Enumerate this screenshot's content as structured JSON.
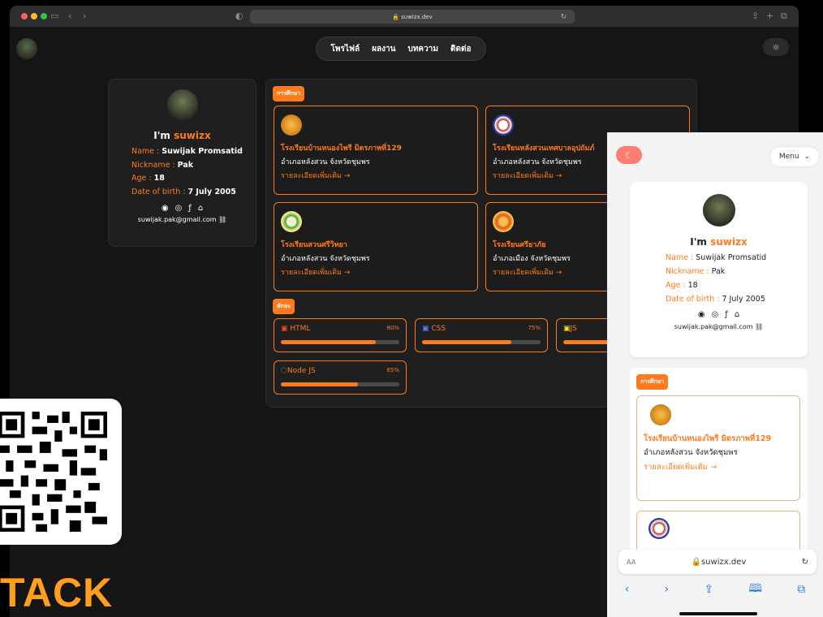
{
  "desktop": {
    "url": "suwizx.dev",
    "nav": [
      "โพรไฟล์",
      "ผลงาน",
      "บทความ",
      "ติดต่อ"
    ],
    "profile": {
      "greeting": "I'm ",
      "name_highlight": "suwizx",
      "name_label": "Name : ",
      "name_value": "Suwijak Promsatid",
      "nick_label": "Nickname : ",
      "nick_value": "Pak",
      "age_label": "Age : ",
      "age_value": "18",
      "dob_label": "Date of birth : ",
      "dob_value": "7 July 2005",
      "email": "suwijak.pak@gmail.com"
    },
    "education_badge": "การศึกษา",
    "schools": [
      {
        "name": "โรงเรียนบ้านหนองไพรี มิตรภาพที่129",
        "address": "อำเภอหลังสวน จังหวัดชุมพร",
        "more": "รายละเอียดเพิ่มเติม →",
        "logo_color": "#d98a1f"
      },
      {
        "name": "โรงเรียนหลังสวนเทศบาลอุปถัมภ์",
        "address": "อำเภอหลังสวน จังหวัดชุมพร",
        "more": "รายละเอียดเพิ่มเติม →",
        "logo_color": "#c0392b"
      },
      {
        "name": "โรงเรียนสวนศรีวิทยา",
        "address": "อำเภอหลังสวน จังหวัดชุมพร",
        "more": "รายละเอียดเพิ่มเติม →",
        "logo_color": "#3fa34d"
      },
      {
        "name": "โรงเรียนศรียาภัย",
        "address": "อำเภอเมือง จังหวัดชุมพร",
        "more": "รายละเอียดเพิ่มเติม →",
        "logo_color": "#e05a1a"
      }
    ],
    "skills_badge": "ทักษะ",
    "skills": [
      {
        "name": "HTML",
        "percent_label": "80%",
        "percent": 80,
        "icon_color": "#e44d26"
      },
      {
        "name": "CSS",
        "percent_label": "75%",
        "percent": 75,
        "icon_color": "#264de4"
      },
      {
        "name": "JS",
        "percent_label": "",
        "percent": 85,
        "icon_color": "#f7df1e"
      },
      {
        "name": "Node JS",
        "percent_label": "65%",
        "percent": 65,
        "icon_color": "#3c873a"
      }
    ]
  },
  "overlay": {
    "stack_text": "TACK"
  },
  "mobile": {
    "menu_label": "Menu",
    "profile": {
      "greeting": "I'm ",
      "name_highlight": "suwizx",
      "name_label": "Name : ",
      "name_value": "Suwijak Promsatid",
      "nick_label": "Nickname : ",
      "nick_value": "Pak",
      "age_label": "Age : ",
      "age_value": "18",
      "dob_label": "Date of birth : ",
      "dob_value": "7 July 2005",
      "email": "suwijak.pak@gmail.com"
    },
    "education_badge": "การศึกษา",
    "school_name": "โรงเรียนบ้านหนองไพรี มิตรภาพที่129",
    "school_address": "อำเภอหลังสวน จังหวัดชุมพร",
    "school_more": "รายละเอียดเพิ่มเติม →",
    "url_aa": "AA",
    "url": "suwizx.dev"
  },
  "colors": {
    "accent": "#ff7a1a"
  }
}
